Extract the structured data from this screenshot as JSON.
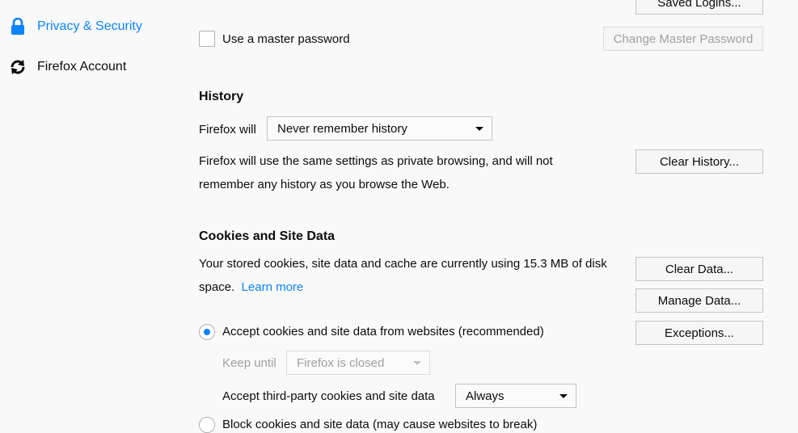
{
  "sidebar": {
    "items": [
      {
        "label": "Privacy & Security",
        "icon": "lock-icon",
        "selected": true
      },
      {
        "label": "Firefox Account",
        "icon": "sync-icon",
        "selected": false
      }
    ]
  },
  "logins": {
    "saved_logins_button": "Saved Logins...",
    "master_password_label": "Use a master password",
    "master_password_checked": false,
    "change_master_password_button": "Change Master Password"
  },
  "history": {
    "heading": "History",
    "firefox_will_label": "Firefox will",
    "mode_select_value": "Never remember history",
    "description_line1": "Firefox will use the same settings as private browsing, and will not",
    "description_line2": "remember any history as you browse the Web.",
    "clear_history_button": "Clear History..."
  },
  "cookies": {
    "heading": "Cookies and Site Data",
    "usage_line1": "Your stored cookies, site data and cache are currently using 15.3 MB of disk",
    "usage_line2": "space.",
    "learn_more_link": "Learn more",
    "clear_data_button": "Clear Data...",
    "manage_data_button": "Manage Data...",
    "exceptions_button": "Exceptions...",
    "accept_radio_label": "Accept cookies and site data from websites (recommended)",
    "accept_radio_checked": true,
    "keep_until_label": "Keep until",
    "keep_until_value": "Firefox is closed",
    "third_party_label": "Accept third-party cookies and site data",
    "third_party_value": "Always",
    "block_radio_label": "Block cookies and site data (may cause websites to break)",
    "block_radio_checked": false
  },
  "colors": {
    "accent": "#0a84ff",
    "background": "#f9f9fa",
    "text": "#0c0c0d",
    "disabled_text": "#a0a0a1"
  }
}
